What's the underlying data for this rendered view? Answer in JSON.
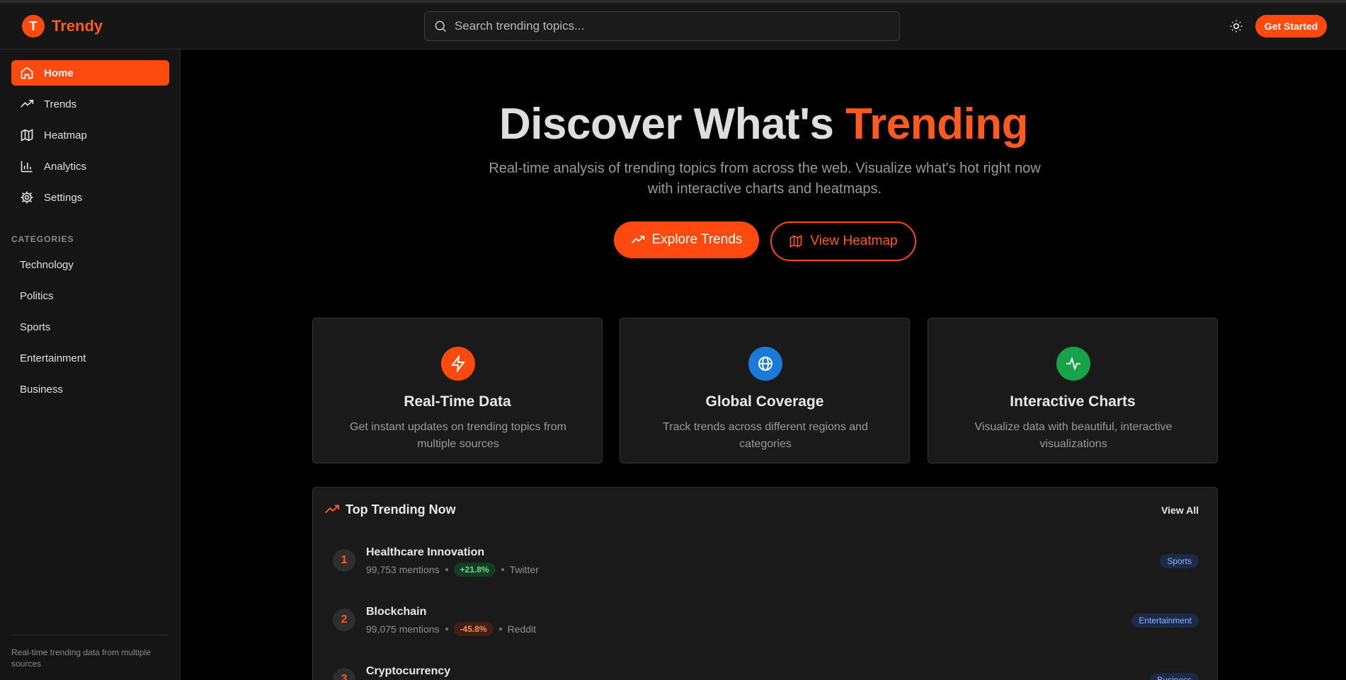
{
  "app": {
    "logo_letter": "T",
    "name": "Trendy"
  },
  "header": {
    "search_placeholder": "Search trending topics...",
    "theme_icon": "sun-icon",
    "cta_label": "Get Started"
  },
  "sidebar": {
    "nav": [
      {
        "label": "Home",
        "icon": "home-icon",
        "active": true
      },
      {
        "label": "Trends",
        "icon": "trending-up-icon",
        "active": false
      },
      {
        "label": "Heatmap",
        "icon": "map-icon",
        "active": false
      },
      {
        "label": "Analytics",
        "icon": "bar-chart-icon",
        "active": false
      },
      {
        "label": "Settings",
        "icon": "gear-icon",
        "active": false
      }
    ],
    "categories_heading": "CATEGORIES",
    "categories": [
      "Technology",
      "Politics",
      "Sports",
      "Entertainment",
      "Business"
    ],
    "footer": "Real-time trending data from multiple sources"
  },
  "hero": {
    "title_prefix": "Discover What's",
    "title_accent": "Trending",
    "subtitle": "Real-time analysis of trending topics from across the web. Visualize what's hot right now with interactive charts and heatmaps.",
    "primary_button": "Explore Trends",
    "secondary_button": "View Heatmap"
  },
  "features": [
    {
      "title": "Real-Time Data",
      "description": "Get instant updates on trending topics from multiple sources",
      "icon": "lightning-icon",
      "color": "#ff4a0f"
    },
    {
      "title": "Global Coverage",
      "description": "Track trends across different regions and categories",
      "icon": "globe-icon",
      "color": "#1a7ad8"
    },
    {
      "title": "Interactive Charts",
      "description": "Visualize data with beautiful, interactive visualizations",
      "icon": "activity-icon",
      "color": "#16a34a"
    }
  ],
  "trending": {
    "heading": "Top Trending Now",
    "view_all": "View All",
    "items": [
      {
        "rank": "1",
        "name": "Healthcare Innovation",
        "mentions": "99,753 mentions",
        "change": "+21.8%",
        "direction": "up",
        "source": "Twitter",
        "category": "Sports"
      },
      {
        "rank": "2",
        "name": "Blockchain",
        "mentions": "99,075 mentions",
        "change": "-45.8%",
        "direction": "down",
        "source": "Reddit",
        "category": "Entertainment"
      },
      {
        "rank": "3",
        "name": "Cryptocurrency",
        "mentions": "",
        "change": "",
        "direction": "up",
        "source": "",
        "category": "Business"
      }
    ]
  },
  "colors": {
    "accent": "#ff4a0f",
    "background": "#000000",
    "panel": "#1a1a1a",
    "sidebar": "#151515"
  }
}
